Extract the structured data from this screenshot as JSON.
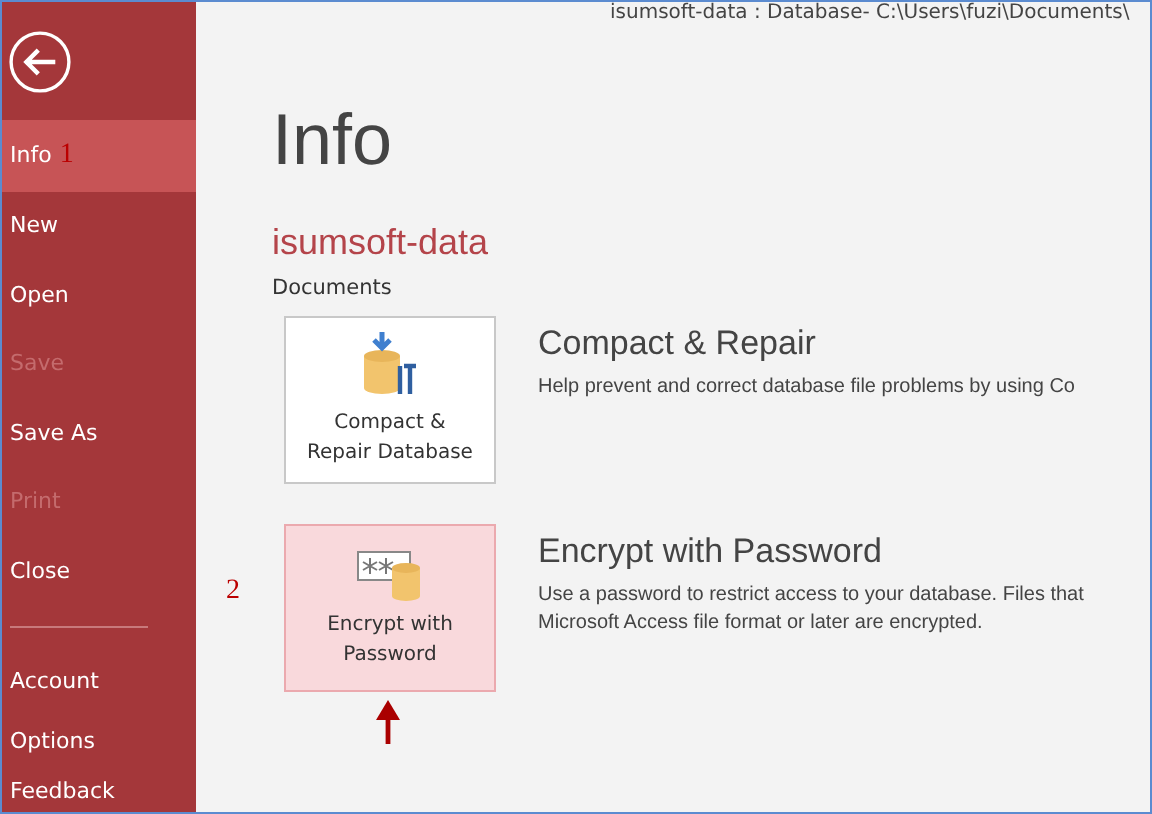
{
  "window": {
    "title": "isumsoft-data : Database- C:\\Users\\fuzi\\Documents\\"
  },
  "sidebar": {
    "items": [
      {
        "label": "Info",
        "selected": true,
        "disabled": false,
        "annotation": "1"
      },
      {
        "label": "New",
        "selected": false,
        "disabled": false
      },
      {
        "label": "Open",
        "selected": false,
        "disabled": false
      },
      {
        "label": "Save",
        "selected": false,
        "disabled": true
      },
      {
        "label": "Save As",
        "selected": false,
        "disabled": false
      },
      {
        "label": "Print",
        "selected": false,
        "disabled": true
      },
      {
        "label": "Close",
        "selected": false,
        "disabled": false
      }
    ],
    "footer_items": [
      {
        "label": "Account",
        "selected": false,
        "disabled": false
      },
      {
        "label": "Options",
        "selected": false,
        "disabled": false
      },
      {
        "label": "Feedback",
        "selected": false,
        "disabled": false
      }
    ]
  },
  "page": {
    "title": "Info",
    "file_name": "isumsoft-data",
    "section": "Documents"
  },
  "actions": [
    {
      "kind": "compact",
      "button": [
        "Compact &",
        "Repair Database"
      ],
      "heading": "Compact & Repair",
      "description": [
        "Help prevent and correct database file problems by using Co"
      ],
      "selected": false
    },
    {
      "kind": "encrypt",
      "button": [
        "Encrypt with",
        "Password"
      ],
      "heading": "Encrypt with Password",
      "description": [
        "Use a password to restrict access to your database. Files that",
        "Microsoft Access file format or later are encrypted."
      ],
      "selected": true,
      "annotation": "2"
    }
  ]
}
